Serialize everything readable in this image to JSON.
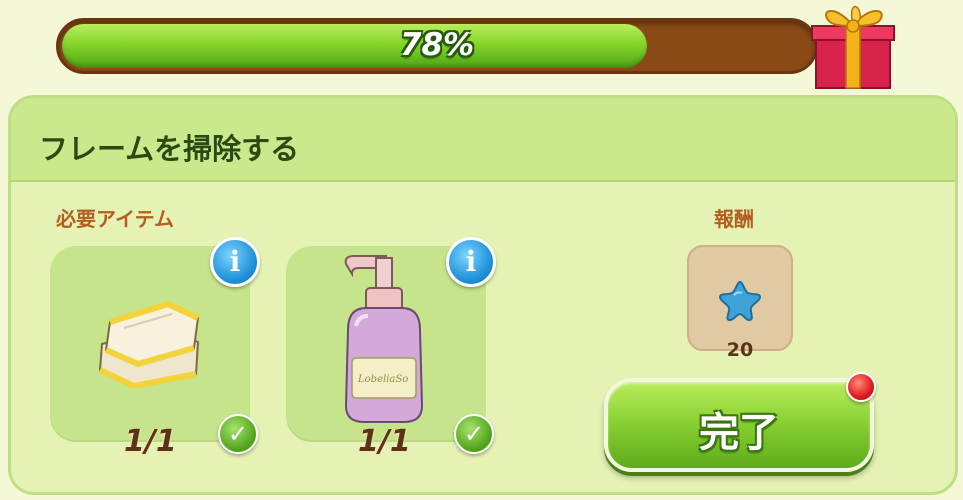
{
  "progress": {
    "label": "78%",
    "value": 0.78
  },
  "task": {
    "title": "フレームを掃除する"
  },
  "required": {
    "label": "必要アイテム",
    "items": [
      {
        "icon": "towel-icon",
        "count": "1/1",
        "info_icon": "info-icon",
        "status_icon": "checkmark-icon"
      },
      {
        "icon": "soap-bottle-icon",
        "count": "1/1",
        "info_icon": "info-icon",
        "status_icon": "checkmark-icon"
      }
    ]
  },
  "reward": {
    "label": "報酬",
    "icon": "star-icon",
    "amount": "20"
  },
  "complete_button": {
    "label": "完了"
  },
  "colors": {
    "accent_green": "#86cf31",
    "panel_bg": "#e4f2b4",
    "label_brown": "#b55e1f",
    "notify_red": "#e0191d"
  }
}
